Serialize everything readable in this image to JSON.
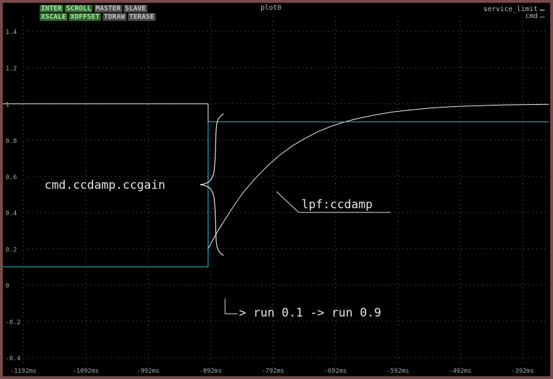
{
  "toolbar": {
    "row1": [
      {
        "label": "INTER",
        "style": "green"
      },
      {
        "label": "SCROLL",
        "style": "green"
      },
      {
        "label": "MASTER",
        "style": "gray"
      },
      {
        "label": "SLAVE",
        "style": "gray"
      }
    ],
    "row2": [
      {
        "label": "XSCALE",
        "style": "green"
      },
      {
        "label": "XOFFSET",
        "style": "green"
      },
      {
        "label": "TDRAW",
        "style": "gray"
      },
      {
        "label": "TERASE",
        "style": "gray"
      }
    ]
  },
  "colors": {
    "frame": "#7a4a4a",
    "background": "#000000",
    "grid": "#6e6e6e",
    "service_limit": "#f0f0f0",
    "cmd": "#3fb6c8",
    "annotation": "#e6e6e6"
  },
  "chart_data": {
    "type": "line",
    "title": "plot0",
    "xlim": [
      -1225,
      -350
    ],
    "ylim": [
      -0.45,
      1.55
    ],
    "x_ticks": [
      -1192,
      -1092,
      -992,
      -892,
      -792,
      -692,
      -592,
      -492,
      -392
    ],
    "x_tick_labels": [
      "-1192ms",
      "-1092ms",
      "-992ms",
      "-892ms",
      "-792ms",
      "-692ms",
      "-592ms",
      "-492ms",
      "-392ms"
    ],
    "y_ticks": [
      -0.4,
      -0.2,
      0,
      0.2,
      0.4,
      0.6,
      0.8,
      1,
      1.2,
      1.4
    ],
    "y_tick_labels": [
      "-0.4",
      "-0.2",
      "0",
      "0.2",
      "0.4",
      "0.6",
      "0.8",
      "1",
      "1.2",
      "1.4"
    ],
    "grid": true,
    "legend_position": "top-right",
    "series": [
      {
        "name": "service_limit",
        "points": [
          [
            -1225,
            1.0
          ],
          [
            -896,
            1.0
          ],
          [
            -896,
            0.2
          ],
          [
            -880,
            0.3
          ],
          [
            -860,
            0.41
          ],
          [
            -840,
            0.51
          ],
          [
            -820,
            0.59
          ],
          [
            -800,
            0.66
          ],
          [
            -780,
            0.72
          ],
          [
            -760,
            0.77
          ],
          [
            -740,
            0.81
          ],
          [
            -720,
            0.846
          ],
          [
            -700,
            0.874
          ],
          [
            -680,
            0.897
          ],
          [
            -660,
            0.916
          ],
          [
            -640,
            0.931
          ],
          [
            -620,
            0.944
          ],
          [
            -600,
            0.955
          ],
          [
            -580,
            0.963
          ],
          [
            -560,
            0.97
          ],
          [
            -540,
            0.976
          ],
          [
            -520,
            0.981
          ],
          [
            -500,
            0.985
          ],
          [
            -480,
            0.988
          ],
          [
            -460,
            0.99
          ],
          [
            -440,
            0.992
          ],
          [
            -420,
            0.994
          ],
          [
            -400,
            0.995
          ],
          [
            -380,
            0.996
          ],
          [
            -350,
            0.997
          ]
        ]
      },
      {
        "name": "cmd",
        "points": [
          [
            -1225,
            0.1
          ],
          [
            -896,
            0.1
          ],
          [
            -896,
            0.9
          ],
          [
            -350,
            0.9
          ]
        ]
      }
    ],
    "annotations": [
      {
        "id": "gain",
        "text": "cmd.ccdamp.ccgain"
      },
      {
        "id": "lpf",
        "text": "lpf:ccdamp"
      },
      {
        "id": "run",
        "text": "> run 0.1 -> run 0.9"
      }
    ]
  }
}
